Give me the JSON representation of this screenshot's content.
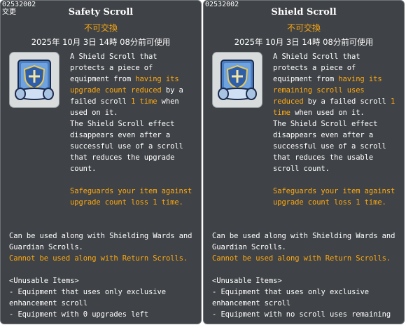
{
  "tooltips": [
    {
      "item_id": "02532002",
      "tag": "交更",
      "title": "Safety Scroll",
      "untradeable": "不可交換",
      "expiry": "2025年 10月 3日 14時 08分前可使用",
      "icon": "scroll-icon",
      "desc": {
        "intro_lines": [
          "A Shield Scroll that",
          "protects a piece of",
          "equipment from "
        ],
        "hl_1": "having its",
        "hl_2": "upgrade count reduced",
        "mid_1": " by a",
        "mid_2": "failed scroll ",
        "hl_3": "1 time",
        "mid_3": " when",
        "lines_after": [
          "used on it.",
          "The Shield Scroll effect",
          "disappears even after a",
          "successful use of a scroll",
          "that reduces the upgrade",
          "count."
        ],
        "safeguard": [
          "Safeguards your item against",
          "upgrade count loss 1 time."
        ]
      },
      "notes": {
        "line_1": "Can be used along with Shielding Wards and",
        "line_2": "Guardian Scrolls.",
        "warning": "Cannot be used along with Return Scrolls.",
        "unusable_header": "<Unusable Items>",
        "unusable": [
          "- Equipment that uses only exclusive",
          "enhancement scroll",
          "- Equipment with 0 upgrades left"
        ]
      }
    },
    {
      "item_id": "02532002",
      "tag": "",
      "title": "Shield Scroll",
      "untradeable": "不可交換",
      "expiry": "2025年 10月 3日 14時 08分前可使用",
      "icon": "scroll-icon",
      "desc": {
        "intro_lines": [
          "A Shield Scroll that",
          "protects a piece of",
          "equipment from "
        ],
        "hl_1": "having its",
        "hl_2a": "remaining scroll uses",
        "hl_2b": "reduced",
        "mid_1": " by a failed scroll ",
        "hl_3": "1",
        "hl_3b": "time",
        "mid_3": " when used on it.",
        "lines_after": [
          "The Shield Scroll effect",
          "disappears even after a",
          "successful use of a scroll",
          "that reduces the usable",
          "scroll count."
        ],
        "safeguard": [
          "Safeguards your item against",
          "upgrade count loss 1 time."
        ]
      },
      "notes": {
        "line_1": "Can be used along with Shielding Wards and",
        "line_2": "Guardian Scrolls.",
        "warning": "Cannot be used along with Return Scrolls.",
        "unusable_header": "<Unusable Items>",
        "unusable": [
          "- Equipment that uses only exclusive",
          "enhancement scroll",
          "- Equipment with no scroll uses remaining"
        ]
      }
    }
  ],
  "colors": {
    "panel_bg": "#3f4246",
    "highlight": "#ffaa11",
    "text": "#ffffff"
  }
}
